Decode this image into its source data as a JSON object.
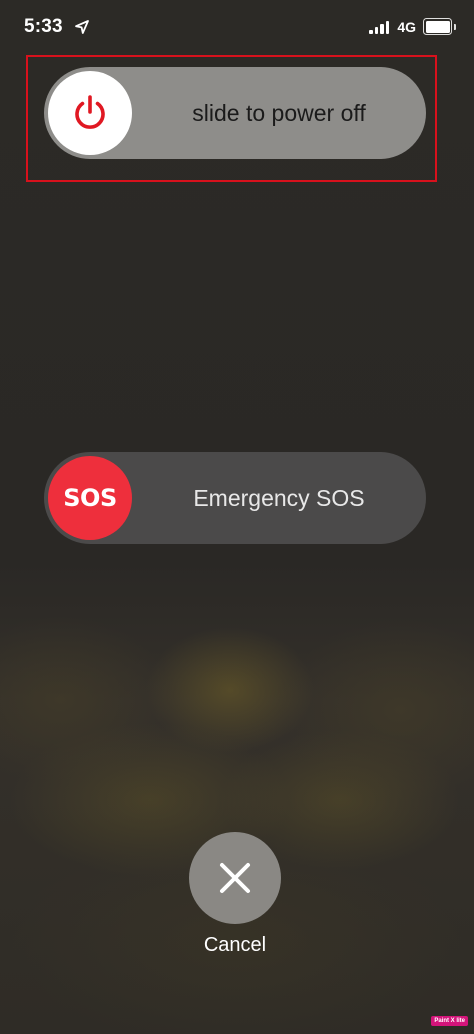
{
  "status_bar": {
    "time": "5:33",
    "network": "4G",
    "icons": [
      "location-arrow-icon",
      "cellular-signal-icon",
      "battery-icon"
    ]
  },
  "power_slider": {
    "label": "slide to power off",
    "icon": "power-icon",
    "icon_color": "#e01822"
  },
  "sos_slider": {
    "knob_text": "SOS",
    "label": "Emergency SOS",
    "knob_color": "#ee2f3c"
  },
  "cancel": {
    "label": "Cancel",
    "icon": "close-icon"
  },
  "annotation": {
    "highlight_color": "#d8111c"
  },
  "watermark": {
    "text": "Paint X lite"
  }
}
